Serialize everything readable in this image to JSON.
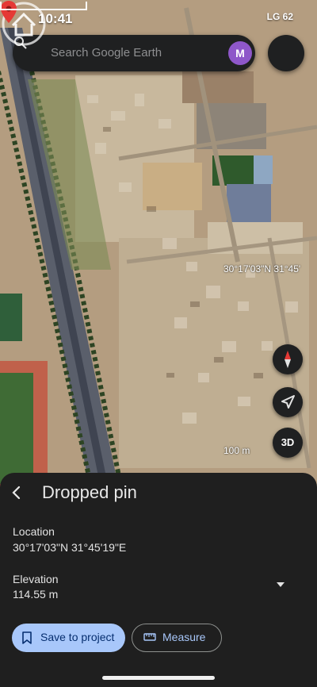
{
  "status_bar": {
    "time": "10:41",
    "right_text": "LG 62"
  },
  "search": {
    "placeholder": "Search Google Earth",
    "avatar_initial": "M"
  },
  "map": {
    "coordinate_overlay": "30°17'03\"N 31°45'",
    "scale_label": "100 m",
    "controls": {
      "compass": "compass-icon",
      "locate": "navigation-arrow-icon",
      "three_d_label": "3D"
    }
  },
  "sheet": {
    "title": "Dropped pin",
    "location_label": "Location",
    "location_value": "30°17'03\"N 31°45'19\"E",
    "elevation_label": "Elevation",
    "elevation_value": "114.55 m",
    "save_button_label": "Save to project",
    "measure_button_label": "Measure"
  },
  "colors": {
    "sheet_bg": "#1f1f1f",
    "primary_button": "#a8c7fa",
    "primary_button_text": "#062e6f",
    "pin_red": "#e53935",
    "avatar": "#8e57c9"
  }
}
